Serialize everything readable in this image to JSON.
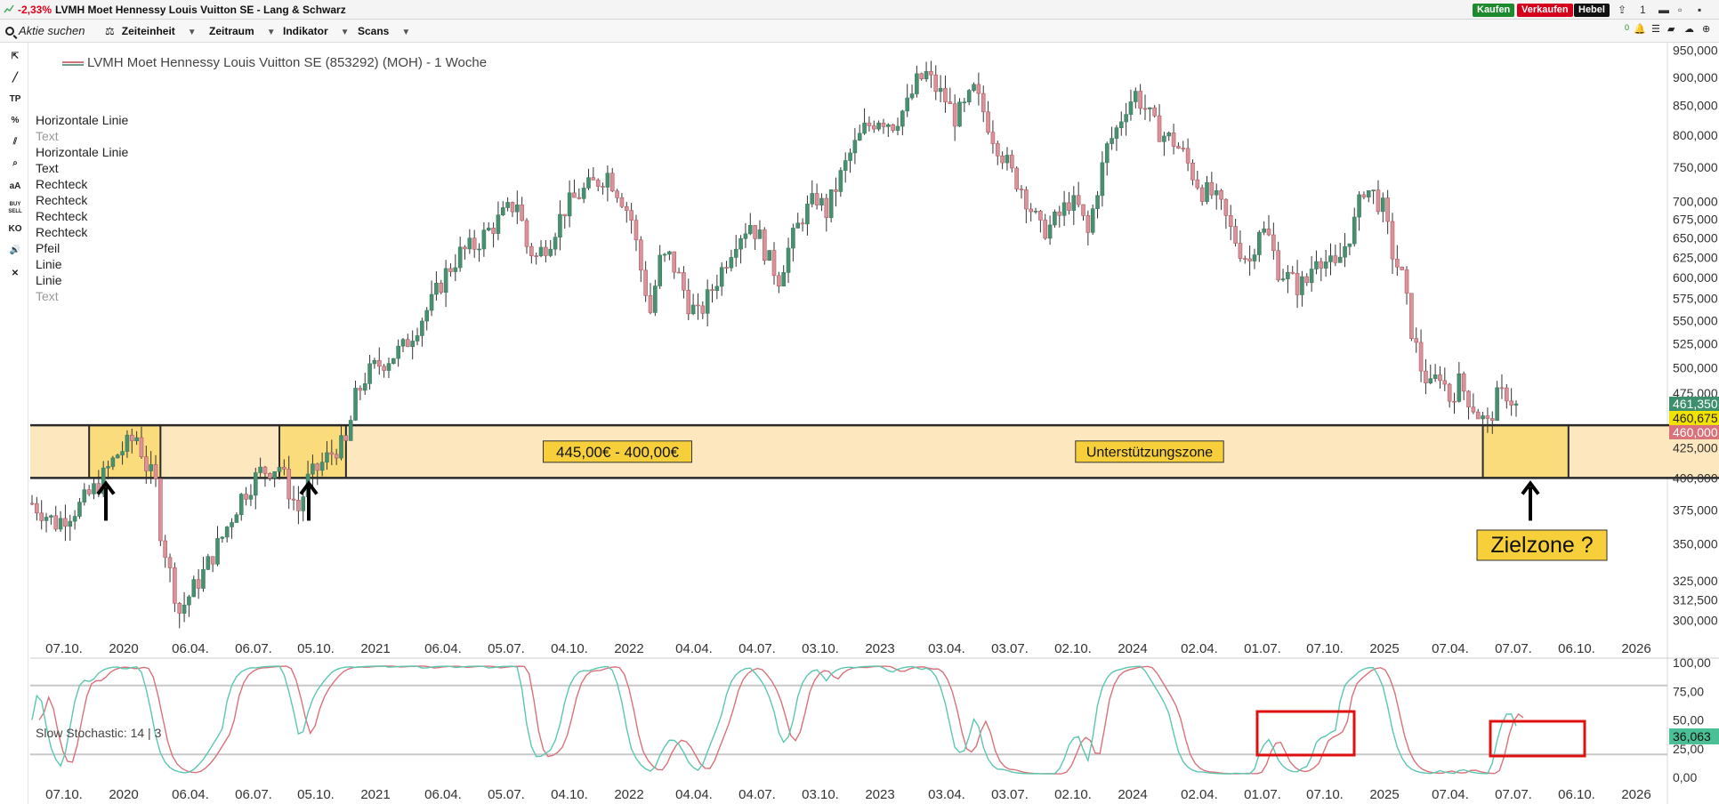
{
  "window": {
    "change": "-2,33%",
    "title": "LVMH Moet Hennessy Louis Vuitton SE - Lang & Schwarz",
    "buy_label": "Kaufen",
    "sell_label": "Verkaufen",
    "lever_label": "Hebel",
    "counter": "1",
    "colors": {
      "negative": "#e0001a",
      "buy": "#1e8a2e",
      "sell": "#d6001c",
      "lever": "#111111"
    }
  },
  "menu": {
    "search_placeholder": "Aktie suchen",
    "items": [
      "Zeiteinheit",
      "Zeitraum",
      "Indikator",
      "Scans"
    ],
    "alert_count": "0"
  },
  "toolbar": {
    "tools": [
      {
        "name": "cursor-tool-icon",
        "glyph": "⇱"
      },
      {
        "name": "line-tool-icon",
        "glyph": "╱"
      },
      {
        "name": "tp-tool-icon",
        "glyph": "TP"
      },
      {
        "name": "percent-tool-icon",
        "glyph": "%"
      },
      {
        "name": "parallel-lines-tool-icon",
        "glyph": "⫽"
      },
      {
        "name": "zoom-tool-icon",
        "glyph": "⌕"
      },
      {
        "name": "text-size-tool-icon",
        "glyph": "aA"
      },
      {
        "name": "buy-sell-tool-icon",
        "glyph": "BUY SELL"
      },
      {
        "name": "ko-tool-icon",
        "glyph": "KO"
      },
      {
        "name": "sound-tool-icon",
        "glyph": "🔊"
      },
      {
        "name": "close-tool-icon",
        "glyph": "✕"
      }
    ]
  },
  "chart": {
    "title": "LVMH Moet Hennessy Louis Vuitton SE (853292) (MOH) - 1 Woche",
    "drawings": [
      {
        "label": "Horizontale Linie",
        "muted": false
      },
      {
        "label": "Text",
        "muted": true
      },
      {
        "label": "Horizontale Linie",
        "muted": false
      },
      {
        "label": "Text",
        "muted": false
      },
      {
        "label": "Rechteck",
        "muted": false
      },
      {
        "label": "Rechteck",
        "muted": false
      },
      {
        "label": "Rechteck",
        "muted": false
      },
      {
        "label": "Rechteck",
        "muted": false
      },
      {
        "label": "Pfeil",
        "muted": false
      },
      {
        "label": "Linie",
        "muted": false
      },
      {
        "label": "Linie",
        "muted": false
      },
      {
        "label": "Text",
        "muted": true
      }
    ],
    "annotations": {
      "range_label": "445,00€ - 400,00€",
      "support_label": "Unterstützungszone",
      "target_label": "Zielzone ?"
    },
    "price_tags": [
      {
        "value": "461,350",
        "color": "#3d8f6e",
        "text_color": "#ffffff"
      },
      {
        "value": "460,675",
        "color": "#f2e200",
        "text_color": "#222222"
      },
      {
        "value": "460,000",
        "color": "#d9727a",
        "text_color": "#ffffff"
      }
    ],
    "stoch_label": "Slow Stochastic: 14 | 3",
    "stoch_tag": "36,063",
    "stoch_tag_color": "#4bbf96"
  },
  "chart_data": [
    {
      "type": "candlestick",
      "title": "LVMH Moet Hennessy Louis Vuitton SE (853292) (MOH) - 1 Woche",
      "x_tick_labels": [
        "07.10.",
        "2020",
        "06.04.",
        "06.07.",
        "05.10.",
        "2021",
        "06.04.",
        "05.07.",
        "04.10.",
        "2022",
        "04.04.",
        "04.07.",
        "03.10.",
        "2023",
        "03.04.",
        "03.07.",
        "02.10.",
        "2024",
        "02.04.",
        "01.07.",
        "07.10.",
        "2025",
        "07.04.",
        "07.07.",
        "06.10.",
        "2026"
      ],
      "y_scale": "log",
      "y_tick_labels": [
        "950,000",
        "900,000",
        "850,000",
        "800,000",
        "750,000",
        "700,000",
        "675,000",
        "650,000",
        "625,000",
        "600,000",
        "575,000",
        "550,000",
        "525,000",
        "500,000",
        "475,000",
        "425,000",
        "400,000",
        "375,000",
        "350,000",
        "325,000",
        "312,500",
        "300,000"
      ],
      "y_ticks": [
        950,
        900,
        850,
        800,
        750,
        700,
        675,
        650,
        625,
        600,
        575,
        550,
        525,
        500,
        475,
        425,
        400,
        375,
        350,
        325,
        312.5,
        300
      ],
      "ylim": [
        288,
        965
      ],
      "support_zone": [
        400,
        445
      ],
      "price_path": [
        [
          0,
          380
        ],
        [
          5,
          365
        ],
        [
          10,
          378
        ],
        [
          14,
          395
        ],
        [
          18,
          420
        ],
        [
          22,
          435
        ],
        [
          24,
          410
        ],
        [
          26,
          395
        ],
        [
          27,
          360
        ],
        [
          29,
          330
        ],
        [
          31,
          305
        ],
        [
          33,
          315
        ],
        [
          36,
          330
        ],
        [
          40,
          355
        ],
        [
          44,
          385
        ],
        [
          48,
          405
        ],
        [
          52,
          410
        ],
        [
          54,
          390
        ],
        [
          56,
          375
        ],
        [
          58,
          398
        ],
        [
          61,
          412
        ],
        [
          64,
          425
        ],
        [
          66,
          428
        ],
        [
          68,
          470
        ],
        [
          70,
          490
        ],
        [
          72,
          500
        ],
        [
          75,
          510
        ],
        [
          78,
          520
        ],
        [
          81,
          545
        ],
        [
          84,
          570
        ],
        [
          87,
          605
        ],
        [
          90,
          630
        ],
        [
          93,
          640
        ],
        [
          96,
          660
        ],
        [
          99,
          680
        ],
        [
          102,
          700
        ],
        [
          104,
          640
        ],
        [
          106,
          625
        ],
        [
          109,
          650
        ],
        [
          112,
          690
        ],
        [
          115,
          710
        ],
        [
          118,
          725
        ],
        [
          121,
          740
        ],
        [
          124,
          705
        ],
        [
          126,
          675
        ],
        [
          128,
          610
        ],
        [
          130,
          560
        ],
        [
          132,
          620
        ],
        [
          134,
          625
        ],
        [
          136,
          600
        ],
        [
          138,
          570
        ],
        [
          140,
          555
        ],
        [
          142,
          575
        ],
        [
          145,
          610
        ],
        [
          148,
          650
        ],
        [
          151,
          670
        ],
        [
          153,
          650
        ],
        [
          155,
          620
        ],
        [
          157,
          600
        ],
        [
          159,
          635
        ],
        [
          162,
          680
        ],
        [
          165,
          705
        ],
        [
          167,
          685
        ],
        [
          169,
          720
        ],
        [
          172,
          770
        ],
        [
          175,
          810
        ],
        [
          178,
          830
        ],
        [
          181,
          820
        ],
        [
          184,
          850
        ],
        [
          186,
          890
        ],
        [
          188,
          905
        ],
        [
          190,
          880
        ],
        [
          192,
          860
        ],
        [
          194,
          830
        ],
        [
          196,
          845
        ],
        [
          198,
          875
        ],
        [
          200,
          840
        ],
        [
          202,
          800
        ],
        [
          204,
          770
        ],
        [
          206,
          740
        ],
        [
          208,
          720
        ],
        [
          210,
          690
        ],
        [
          212,
          660
        ],
        [
          214,
          665
        ],
        [
          216,
          680
        ],
        [
          218,
          700
        ],
        [
          220,
          690
        ],
        [
          222,
          655
        ],
        [
          224,
          720
        ],
        [
          226,
          780
        ],
        [
          228,
          810
        ],
        [
          230,
          850
        ],
        [
          232,
          870
        ],
        [
          234,
          845
        ],
        [
          236,
          815
        ],
        [
          238,
          800
        ],
        [
          240,
          790
        ],
        [
          242,
          770
        ],
        [
          244,
          740
        ],
        [
          246,
          715
        ],
        [
          248,
          710
        ],
        [
          250,
          690
        ],
        [
          252,
          660
        ],
        [
          254,
          635
        ],
        [
          256,
          620
        ],
        [
          258,
          665
        ],
        [
          260,
          650
        ],
        [
          262,
          610
        ],
        [
          264,
          600
        ],
        [
          266,
          590
        ],
        [
          268,
          595
        ],
        [
          270,
          630
        ],
        [
          272,
          620
        ],
        [
          274,
          610
        ],
        [
          276,
          640
        ],
        [
          278,
          670
        ],
        [
          280,
          720
        ],
        [
          282,
          710
        ],
        [
          284,
          690
        ],
        [
          286,
          630
        ],
        [
          288,
          600
        ],
        [
          290,
          540
        ],
        [
          292,
          500
        ],
        [
          294,
          480
        ],
        [
          296,
          495
        ],
        [
          298,
          470
        ],
        [
          300,
          485
        ],
        [
          302,
          470
        ],
        [
          304,
          455
        ],
        [
          306,
          445
        ],
        [
          308,
          470
        ],
        [
          310,
          475
        ],
        [
          312,
          462
        ]
      ]
    },
    {
      "type": "line",
      "title": "Slow Stochastic: 14 | 3",
      "series": [
        {
          "color": "#5cc7b0"
        },
        {
          "color": "#d9727a"
        }
      ],
      "y_tick_labels": [
        "100,00",
        "75,00",
        "50,00",
        "25,00",
        "0,00"
      ],
      "y_ticks": [
        100,
        75,
        50,
        25,
        0
      ],
      "ylim": [
        0,
        100
      ],
      "levels": [
        80,
        20
      ],
      "last_value": 36.063
    }
  ]
}
